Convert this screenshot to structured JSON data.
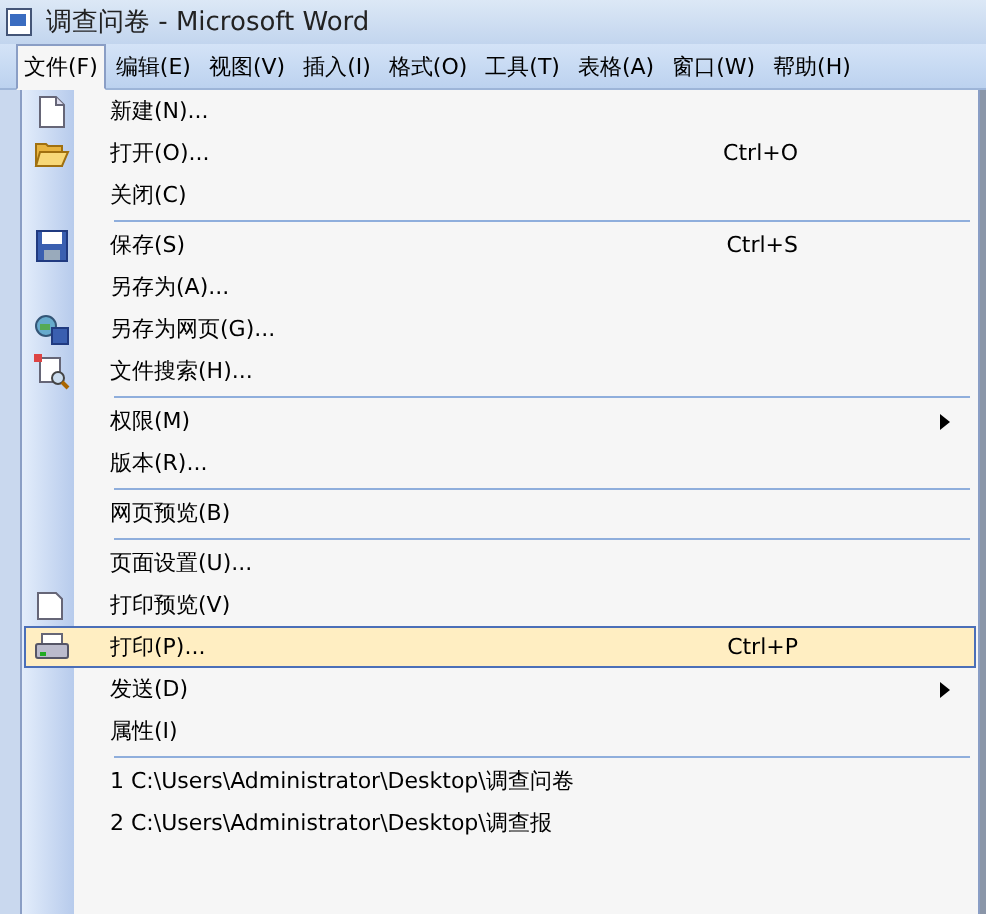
{
  "window": {
    "title": "调查问卷 - Microsoft Word"
  },
  "menubar": [
    {
      "label": "文件(F)",
      "selected": true
    },
    {
      "label": "编辑(E)",
      "selected": false
    },
    {
      "label": "视图(V)",
      "selected": false
    },
    {
      "label": "插入(I)",
      "selected": false
    },
    {
      "label": "格式(O)",
      "selected": false
    },
    {
      "label": "工具(T)",
      "selected": false
    },
    {
      "label": "表格(A)",
      "selected": false
    },
    {
      "label": "窗口(W)",
      "selected": false
    },
    {
      "label": "帮助(H)",
      "selected": false
    }
  ],
  "menu": [
    {
      "kind": "document",
      "label": "新建(N)...",
      "selected": false
    },
    {
      "kind": "folder",
      "label": "打开(O)...",
      "shortcut": "Ctrl+O",
      "selected": false
    },
    {
      "kind": "item",
      "label": "关闭(C)",
      "selected": false
    },
    {
      "kind": "separator"
    },
    {
      "kind": "disk",
      "label": "保存(S)",
      "shortcut": "Ctrl+S",
      "selected": false
    },
    {
      "kind": "item",
      "label": "另存为(A)...",
      "selected": false
    },
    {
      "kind": "globe",
      "label": "另存为网页(G)...",
      "selected": false
    },
    {
      "kind": "find",
      "label": "文件搜索(H)...",
      "selected": false
    },
    {
      "kind": "separator"
    },
    {
      "kind": "item",
      "label": "权限(M)",
      "submenu": true,
      "selected": false
    },
    {
      "kind": "item",
      "label": "版本(R)...",
      "selected": false
    },
    {
      "kind": "separator"
    },
    {
      "kind": "item",
      "label": "网页预览(B)",
      "selected": false
    },
    {
      "kind": "separator"
    },
    {
      "kind": "item",
      "label": "页面设置(U)...",
      "selected": false
    },
    {
      "kind": "preview",
      "label": "打印预览(V)",
      "selected": false
    },
    {
      "kind": "printer",
      "label": "打印(P)...",
      "shortcut": "Ctrl+P",
      "selected": true
    },
    {
      "kind": "item",
      "label": "发送(D)",
      "submenu": true,
      "selected": false
    },
    {
      "kind": "item",
      "label": "属性(I)",
      "selected": false
    },
    {
      "kind": "separator"
    },
    {
      "kind": "item",
      "label": "1 C:\\Users\\Administrator\\Desktop\\调查问卷",
      "selected": false
    },
    {
      "kind": "item",
      "label": "2 C:\\Users\\Administrator\\Desktop\\调查报",
      "selected": false
    }
  ]
}
